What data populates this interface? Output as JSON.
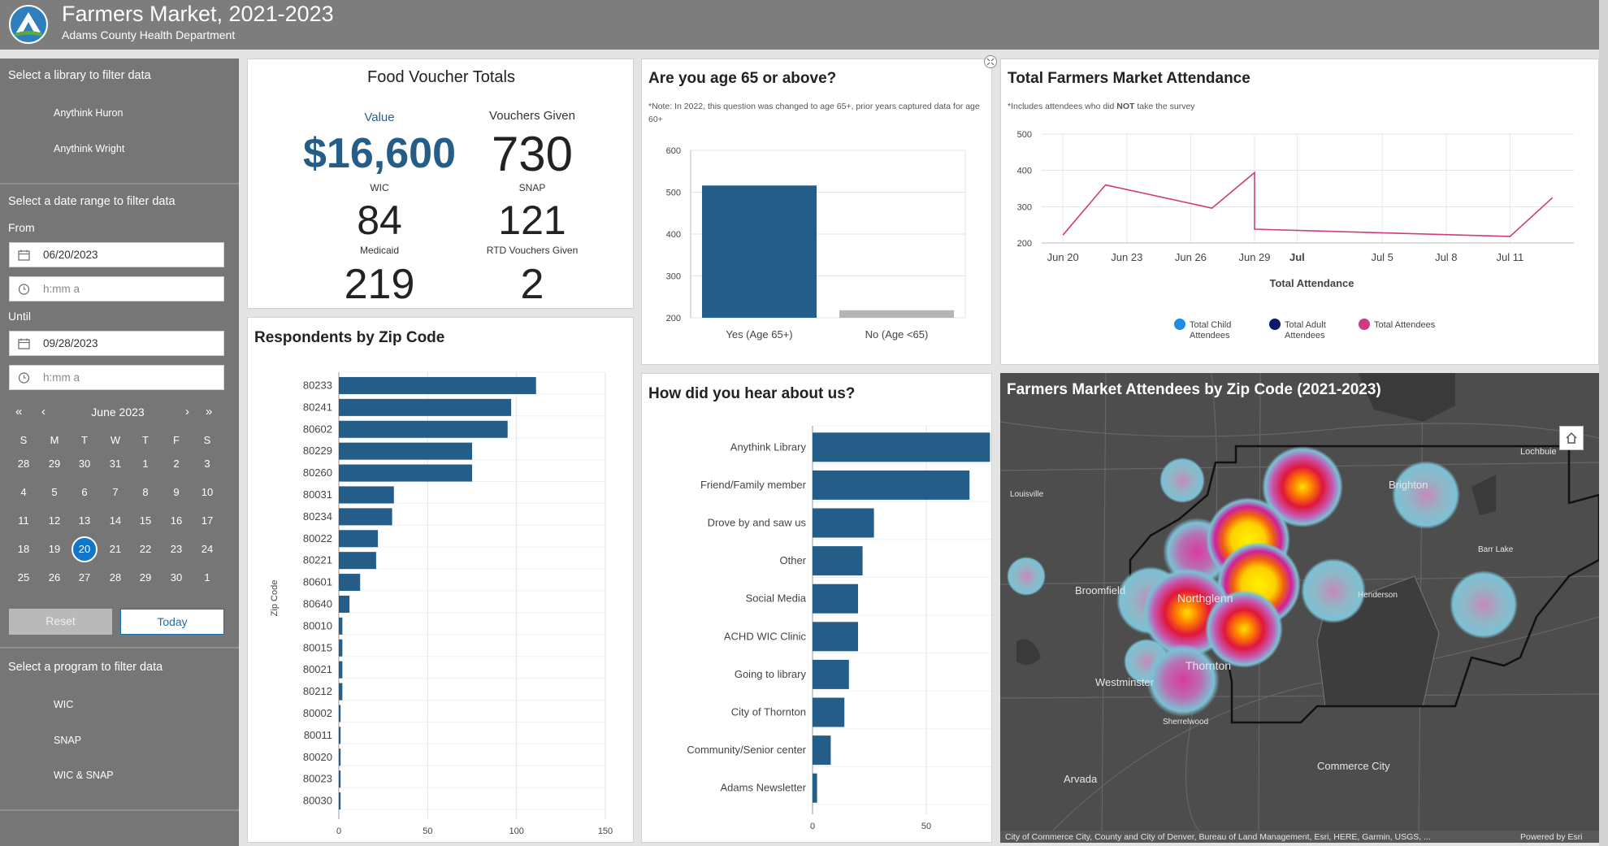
{
  "header": {
    "title": "Farmers Market, 2021-2023",
    "subtitle": "Adams County Health Department"
  },
  "sidebar": {
    "library_heading": "Select a library to filter data",
    "libraries": [
      "Anythink Huron",
      "Anythink Wright"
    ],
    "date_heading": "Select a date range to filter data",
    "from_label": "From",
    "from_date": "06/20/2023",
    "from_time_placeholder": "h:mm a",
    "until_label": "Until",
    "until_date": "09/28/2023",
    "until_time_placeholder": "h:mm a",
    "calendar": {
      "month_label": "June 2023",
      "weekdays": [
        "S",
        "M",
        "T",
        "W",
        "T",
        "F",
        "S"
      ],
      "weeks": [
        [
          "28",
          "29",
          "30",
          "31",
          "1",
          "2",
          "3"
        ],
        [
          "4",
          "5",
          "6",
          "7",
          "8",
          "9",
          "10"
        ],
        [
          "11",
          "12",
          "13",
          "14",
          "15",
          "16",
          "17"
        ],
        [
          "18",
          "19",
          "20",
          "21",
          "22",
          "23",
          "24"
        ],
        [
          "25",
          "26",
          "27",
          "28",
          "29",
          "30",
          "1"
        ]
      ],
      "selected_day": "20",
      "nav": {
        "prev_year": "«",
        "prev_month": "‹",
        "next_month": "›",
        "next_year": "»"
      }
    },
    "reset_label": "Reset",
    "today_label": "Today",
    "program_heading": "Select a program to filter data",
    "programs": [
      "WIC",
      "SNAP",
      "WIC & SNAP"
    ]
  },
  "voucher": {
    "title": "Food Voucher Totals",
    "value_label": "Value",
    "value": "$16,600",
    "given_label": "Vouchers Given",
    "given": "730",
    "wic_label": "WIC",
    "wic": "84",
    "snap_label": "SNAP",
    "snap": "121",
    "medicaid_label": "Medicaid",
    "medicaid": "219",
    "rtd_label": "RTD Vouchers Given",
    "rtd": "2"
  },
  "age": {
    "title": "Are you age 65 or above?",
    "note": "*Note: In 2022, this question was changed to age 65+, prior years captured data for age 60+"
  },
  "attendance": {
    "title": "Total Farmers Market Attendance",
    "note_prefix": "*Includes attendees who did ",
    "note_bold": "NOT",
    "note_suffix": " take the survey"
  },
  "zip": {
    "title": "Respondents by Zip Code"
  },
  "hear": {
    "title": "How did you hear about us?"
  },
  "map": {
    "title": "Farmers Market Attendees by Zip Code (2021-2023)",
    "places": [
      "Lochbuie",
      "Brighton",
      "Louisville",
      "Barr Lake",
      "Broomfield",
      "Northglenn",
      "Henderson",
      "Westminster",
      "Thornton",
      "Sherrelwood",
      "Arvada",
      "Commerce City"
    ],
    "attribution": "City of Commerce City, County and City of Denver, Bureau of Land Management, Esri, HERE, Garmin, USGS, ...",
    "powered": "Powered by Esri",
    "home_icon": "home-icon"
  },
  "colors": {
    "bar": "#245d87",
    "line": "#cf3b7c",
    "header": "#7d7d7d",
    "sidebar": "#767676",
    "selected": "#1176c9"
  },
  "chart_data": [
    {
      "type": "bar",
      "title": "Are you age 65 or above?",
      "categories": [
        "Yes (Age 65+)",
        "No (Age <65)"
      ],
      "values": [
        516,
        218
      ],
      "ylim": [
        200,
        600
      ],
      "yticks": [
        "200",
        "300",
        "400",
        "500",
        "600"
      ],
      "colors": [
        "#245d87",
        "#b5b5b5"
      ],
      "grid": true
    },
    {
      "type": "line",
      "title": "Total Farmers Market Attendance",
      "xlabel": "Total Attendance",
      "x": [
        "2023-06-20",
        "2023-06-22",
        "2023-06-27",
        "2023-06-29",
        "2023-06-29",
        "2023-07-11",
        "2023-07-13"
      ],
      "xticks": [
        "Jun 20",
        "Jun 23",
        "Jun 26",
        "Jun 29",
        "Jul",
        "Jul 5",
        "Jul 8",
        "Jul 11"
      ],
      "ylim": [
        200,
        500
      ],
      "yticks": [
        "200",
        "300",
        "400",
        "500"
      ],
      "series": [
        {
          "name": "Total Child Attendees",
          "color": "#1c8ee6",
          "values": []
        },
        {
          "name": "Total Adult Attendees",
          "color": "#0c1a6e",
          "values": []
        },
        {
          "name": "Total Attendees",
          "color": "#cf3b7c",
          "values": [
            222,
            360,
            296,
            394,
            238,
            218,
            325
          ]
        }
      ],
      "legend_position": "bottom",
      "grid": true
    },
    {
      "type": "bar",
      "orientation": "horizontal",
      "title": "Respondents by Zip Code",
      "ylabel": "Zip Code",
      "categories": [
        "80233",
        "80241",
        "80602",
        "80229",
        "80260",
        "80031",
        "80234",
        "80022",
        "80221",
        "80601",
        "80640",
        "80010",
        "80015",
        "80021",
        "80212",
        "80002",
        "80011",
        "80020",
        "80023",
        "80030"
      ],
      "values": [
        111,
        97,
        95,
        75,
        75,
        31,
        30,
        22,
        21,
        12,
        6,
        2,
        2,
        2,
        2,
        1,
        1,
        1,
        1,
        1
      ],
      "xlim": [
        0,
        150
      ],
      "xticks": [
        "0",
        "50",
        "100",
        "150"
      ],
      "grid": true
    },
    {
      "type": "bar",
      "orientation": "horizontal",
      "title": "How did you hear about us?",
      "categories": [
        "Anythink Library",
        "Friend/Family member",
        "Drove by and saw us",
        "Other",
        "Social Media",
        "ACHD WIC Clinic",
        "Going to library",
        "City of Thornton",
        "Community/Senior center",
        "Adams Newsletter"
      ],
      "values": [
        78,
        69,
        27,
        22,
        20,
        20,
        16,
        14,
        8,
        2
      ],
      "xlim": [
        0,
        100
      ],
      "xticks": [
        "0",
        "50",
        "100"
      ],
      "grid": true
    }
  ]
}
